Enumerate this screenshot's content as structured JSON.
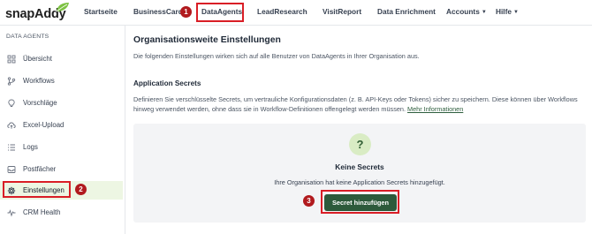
{
  "app": {
    "logo_text": "snapAddy"
  },
  "nav": {
    "items": [
      {
        "label": "Startseite"
      },
      {
        "label": "BusinessCard"
      },
      {
        "label": "DataAgents"
      },
      {
        "label": "LeadResearch"
      },
      {
        "label": "VisitReport"
      },
      {
        "label": "Data Enrichment"
      },
      {
        "label": "Accounts"
      },
      {
        "label": "Hilfe"
      }
    ]
  },
  "sidebar": {
    "heading": "DATA AGENTS",
    "items": [
      {
        "label": "Übersicht",
        "icon": "grid-icon"
      },
      {
        "label": "Workflows",
        "icon": "branch-icon"
      },
      {
        "label": "Vorschläge",
        "icon": "lightbulb-icon"
      },
      {
        "label": "Excel-Upload",
        "icon": "cloud-upload-icon"
      },
      {
        "label": "Logs",
        "icon": "list-icon"
      },
      {
        "label": "Postfächer",
        "icon": "inbox-icon"
      },
      {
        "label": "Einstellungen",
        "icon": "gear-icon",
        "active": true
      },
      {
        "label": "CRM Health",
        "icon": "pulse-icon"
      }
    ]
  },
  "main": {
    "title": "Organisationsweite Einstellungen",
    "description": "Die folgenden Einstellungen wirken sich auf alle Benutzer von DataAgents in Ihrer Organisation aus.",
    "section_title": "Application Secrets",
    "section_desc_1": "Definieren Sie verschlüsselte Secrets, um vertrauliche Konfigurationsdaten (z. B. API-Keys oder Tokens) sicher zu speichern. Diese können über Workflows hinweg verwendet werden, ohne dass sie in Workflow-Definitionen offengelegt werden müssen.",
    "more_info_link": "Mehr Informationen",
    "empty_state": {
      "icon_glyph": "?",
      "title": "Keine Secrets",
      "description": "Ihre Organisation hat keine Application Secrets hinzugefügt.",
      "button_label": "Secret hinzufügen"
    }
  },
  "annotations": {
    "badges": [
      "1",
      "2",
      "3"
    ]
  },
  "colors": {
    "accent_dark_green": "#2d5a3b",
    "active_item_bg": "#edf6e3",
    "highlight_red": "#d91e26",
    "badge_red": "#b11a1e",
    "logo_leaf_green": "#7cc242"
  }
}
